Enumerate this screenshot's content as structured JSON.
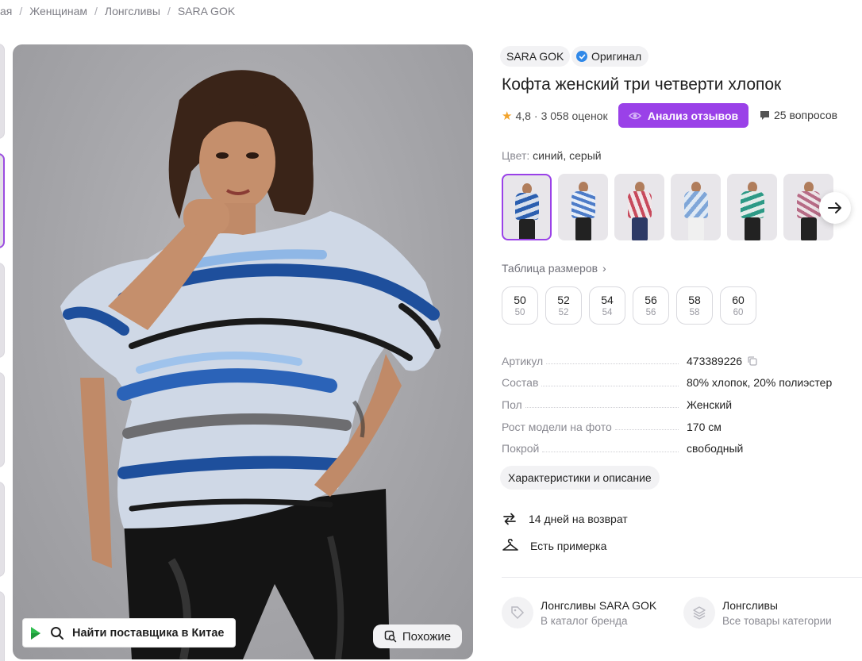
{
  "breadcrumb": {
    "items": [
      "ая",
      "Женщинам",
      "Лонгсливы",
      "SARA GOK"
    ],
    "separator": "/"
  },
  "gallery": {
    "supplier_button": "Найти поставщика в Китае",
    "similar_button": "Похожие"
  },
  "product": {
    "brand": "SARA GOK",
    "original_badge": "Оригинал",
    "title": "Кофта женский три четверти хлопок",
    "rating": "4,8",
    "reviews": "3 058 оценок",
    "analysis_button": "Анализ отзывов",
    "questions": "25 вопросов",
    "color_label": "Цвет:",
    "color_value": "синий, серый",
    "size_table_link": "Таблица размеров",
    "sizes": [
      {
        "main": "50",
        "sub": "50"
      },
      {
        "main": "52",
        "sub": "52"
      },
      {
        "main": "54",
        "sub": "54"
      },
      {
        "main": "56",
        "sub": "56"
      },
      {
        "main": "58",
        "sub": "58"
      },
      {
        "main": "60",
        "sub": "60"
      }
    ],
    "specs": [
      {
        "key": "Артикул",
        "value": "473389226"
      },
      {
        "key": "Состав",
        "value": "80% хлопок, 20% полиэстер"
      },
      {
        "key": "Пол",
        "value": "Женский"
      },
      {
        "key": "Рост модели на фото",
        "value": "170 см"
      },
      {
        "key": "Покрой",
        "value": "свободный"
      }
    ],
    "chars_button": "Характеристики и описание",
    "features": {
      "return": "14 дней на возврат",
      "fitting": "Есть примерка"
    },
    "categories": [
      {
        "title": "Лонгсливы SARA GOK",
        "subtitle": "В каталог бренда"
      },
      {
        "title": "Лонгсливы",
        "subtitle": "Все товары категории"
      }
    ]
  },
  "colors": {
    "accent": "#9a41e8",
    "badge_check": "#2f88e8",
    "star": "#f2a32b"
  }
}
